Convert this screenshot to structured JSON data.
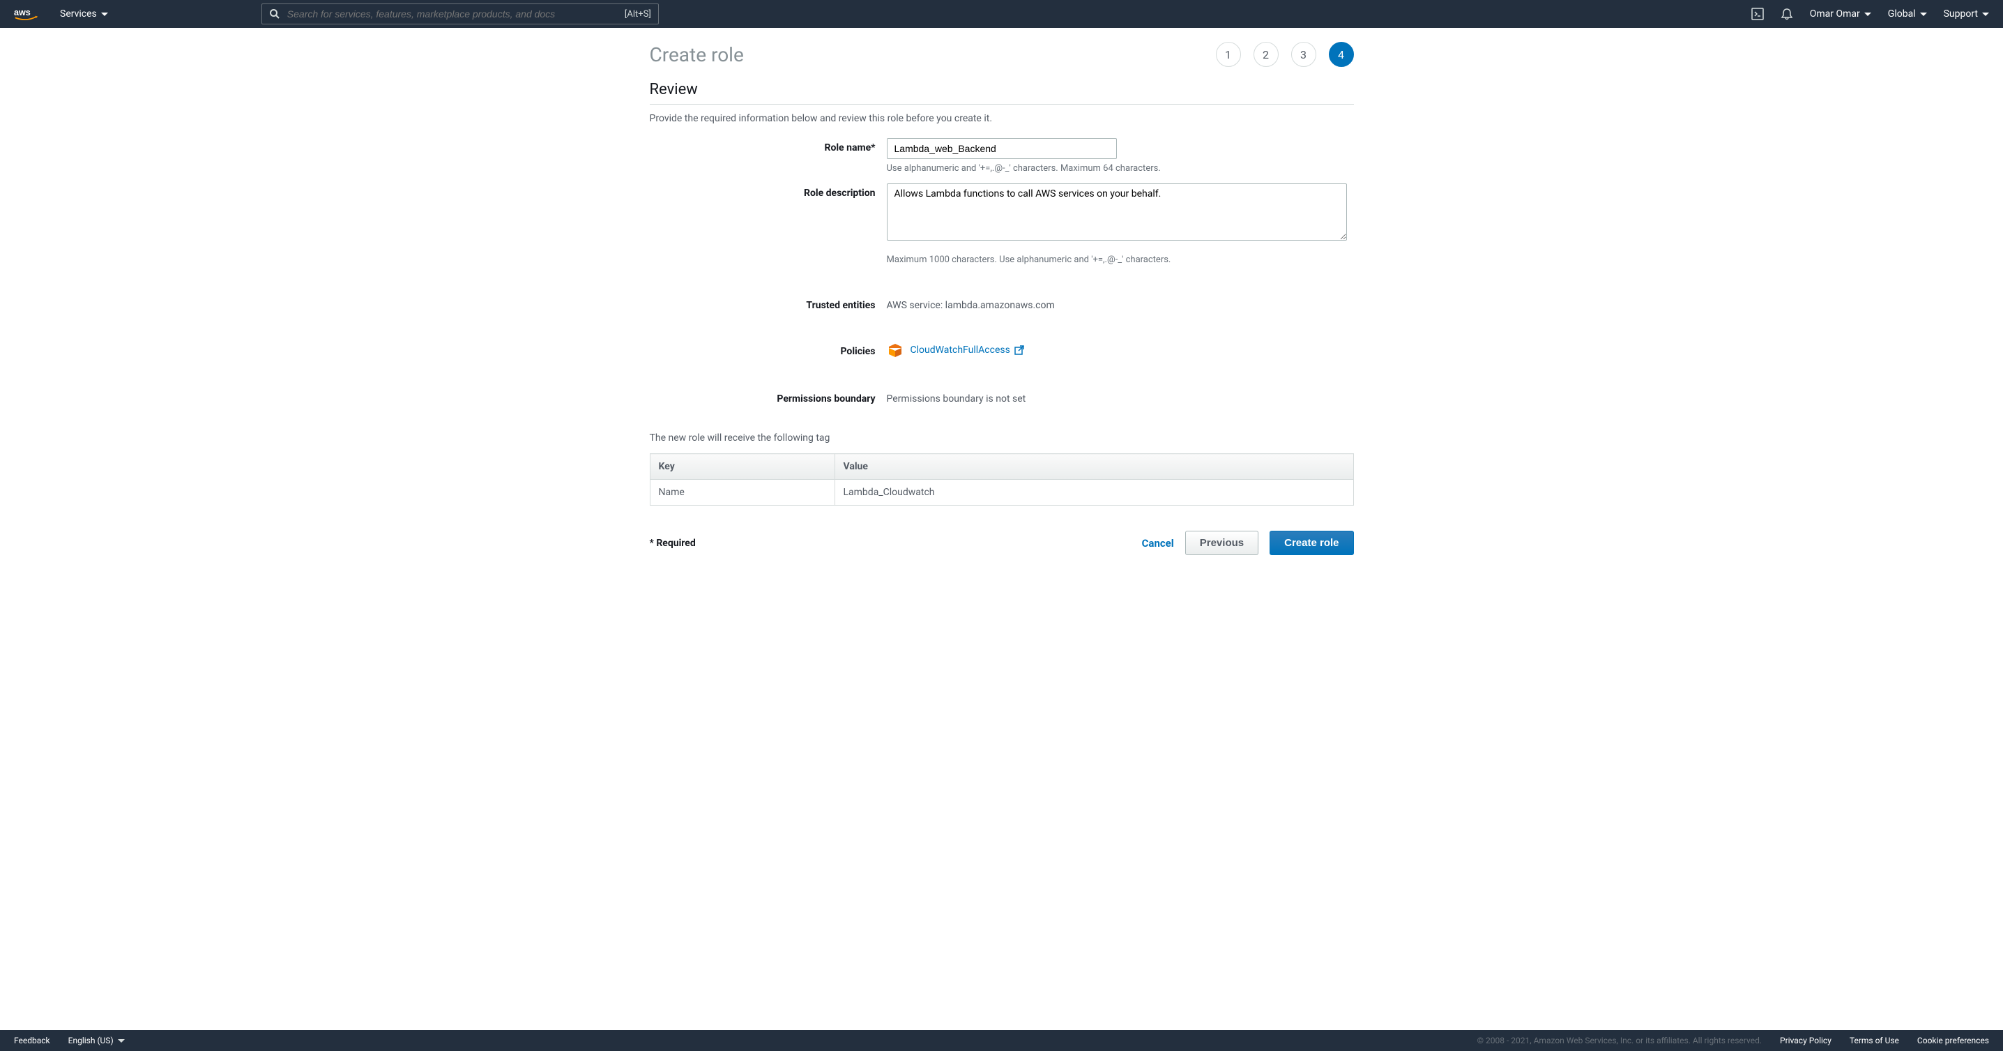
{
  "header": {
    "services": "Services",
    "search_placeholder": "Search for services, features, marketplace products, and docs",
    "search_shortcut": "[Alt+S]",
    "account": "Omar Omar",
    "region": "Global",
    "support": "Support"
  },
  "page": {
    "title": "Create role",
    "steps": [
      "1",
      "2",
      "3",
      "4"
    ],
    "active_step": 4
  },
  "review": {
    "title": "Review",
    "desc": "Provide the required information below and review this role before you create it.",
    "role_name_label": "Role name*",
    "role_name_value": "Lambda_web_Backend",
    "role_name_hint": "Use alphanumeric and '+=,.@-_' characters. Maximum 64 characters.",
    "role_desc_label": "Role description",
    "role_desc_value": "Allows Lambda functions to call AWS services on your behalf.",
    "role_desc_hint": "Maximum 1000 characters. Use alphanumeric and '+=,.@-_' characters.",
    "trusted_label": "Trusted entities",
    "trusted_value": "AWS service: lambda.amazonaws.com",
    "policies_label": "Policies",
    "policies_link": "CloudWatchFullAccess",
    "boundary_label": "Permissions boundary",
    "boundary_value": "Permissions boundary is not set"
  },
  "tags": {
    "intro": "The new role will receive the following tag",
    "key_header": "Key",
    "value_header": "Value",
    "rows": [
      {
        "key": "Name",
        "value": "Lambda_Cloudwatch"
      }
    ]
  },
  "actions": {
    "required": "* Required",
    "cancel": "Cancel",
    "previous": "Previous",
    "create": "Create role"
  },
  "footer": {
    "feedback": "Feedback",
    "language": "English (US)",
    "copyright": "© 2008 - 2021, Amazon Web Services, Inc. or its affiliates. All rights reserved.",
    "privacy": "Privacy Policy",
    "terms": "Terms of Use",
    "cookies": "Cookie preferences"
  }
}
